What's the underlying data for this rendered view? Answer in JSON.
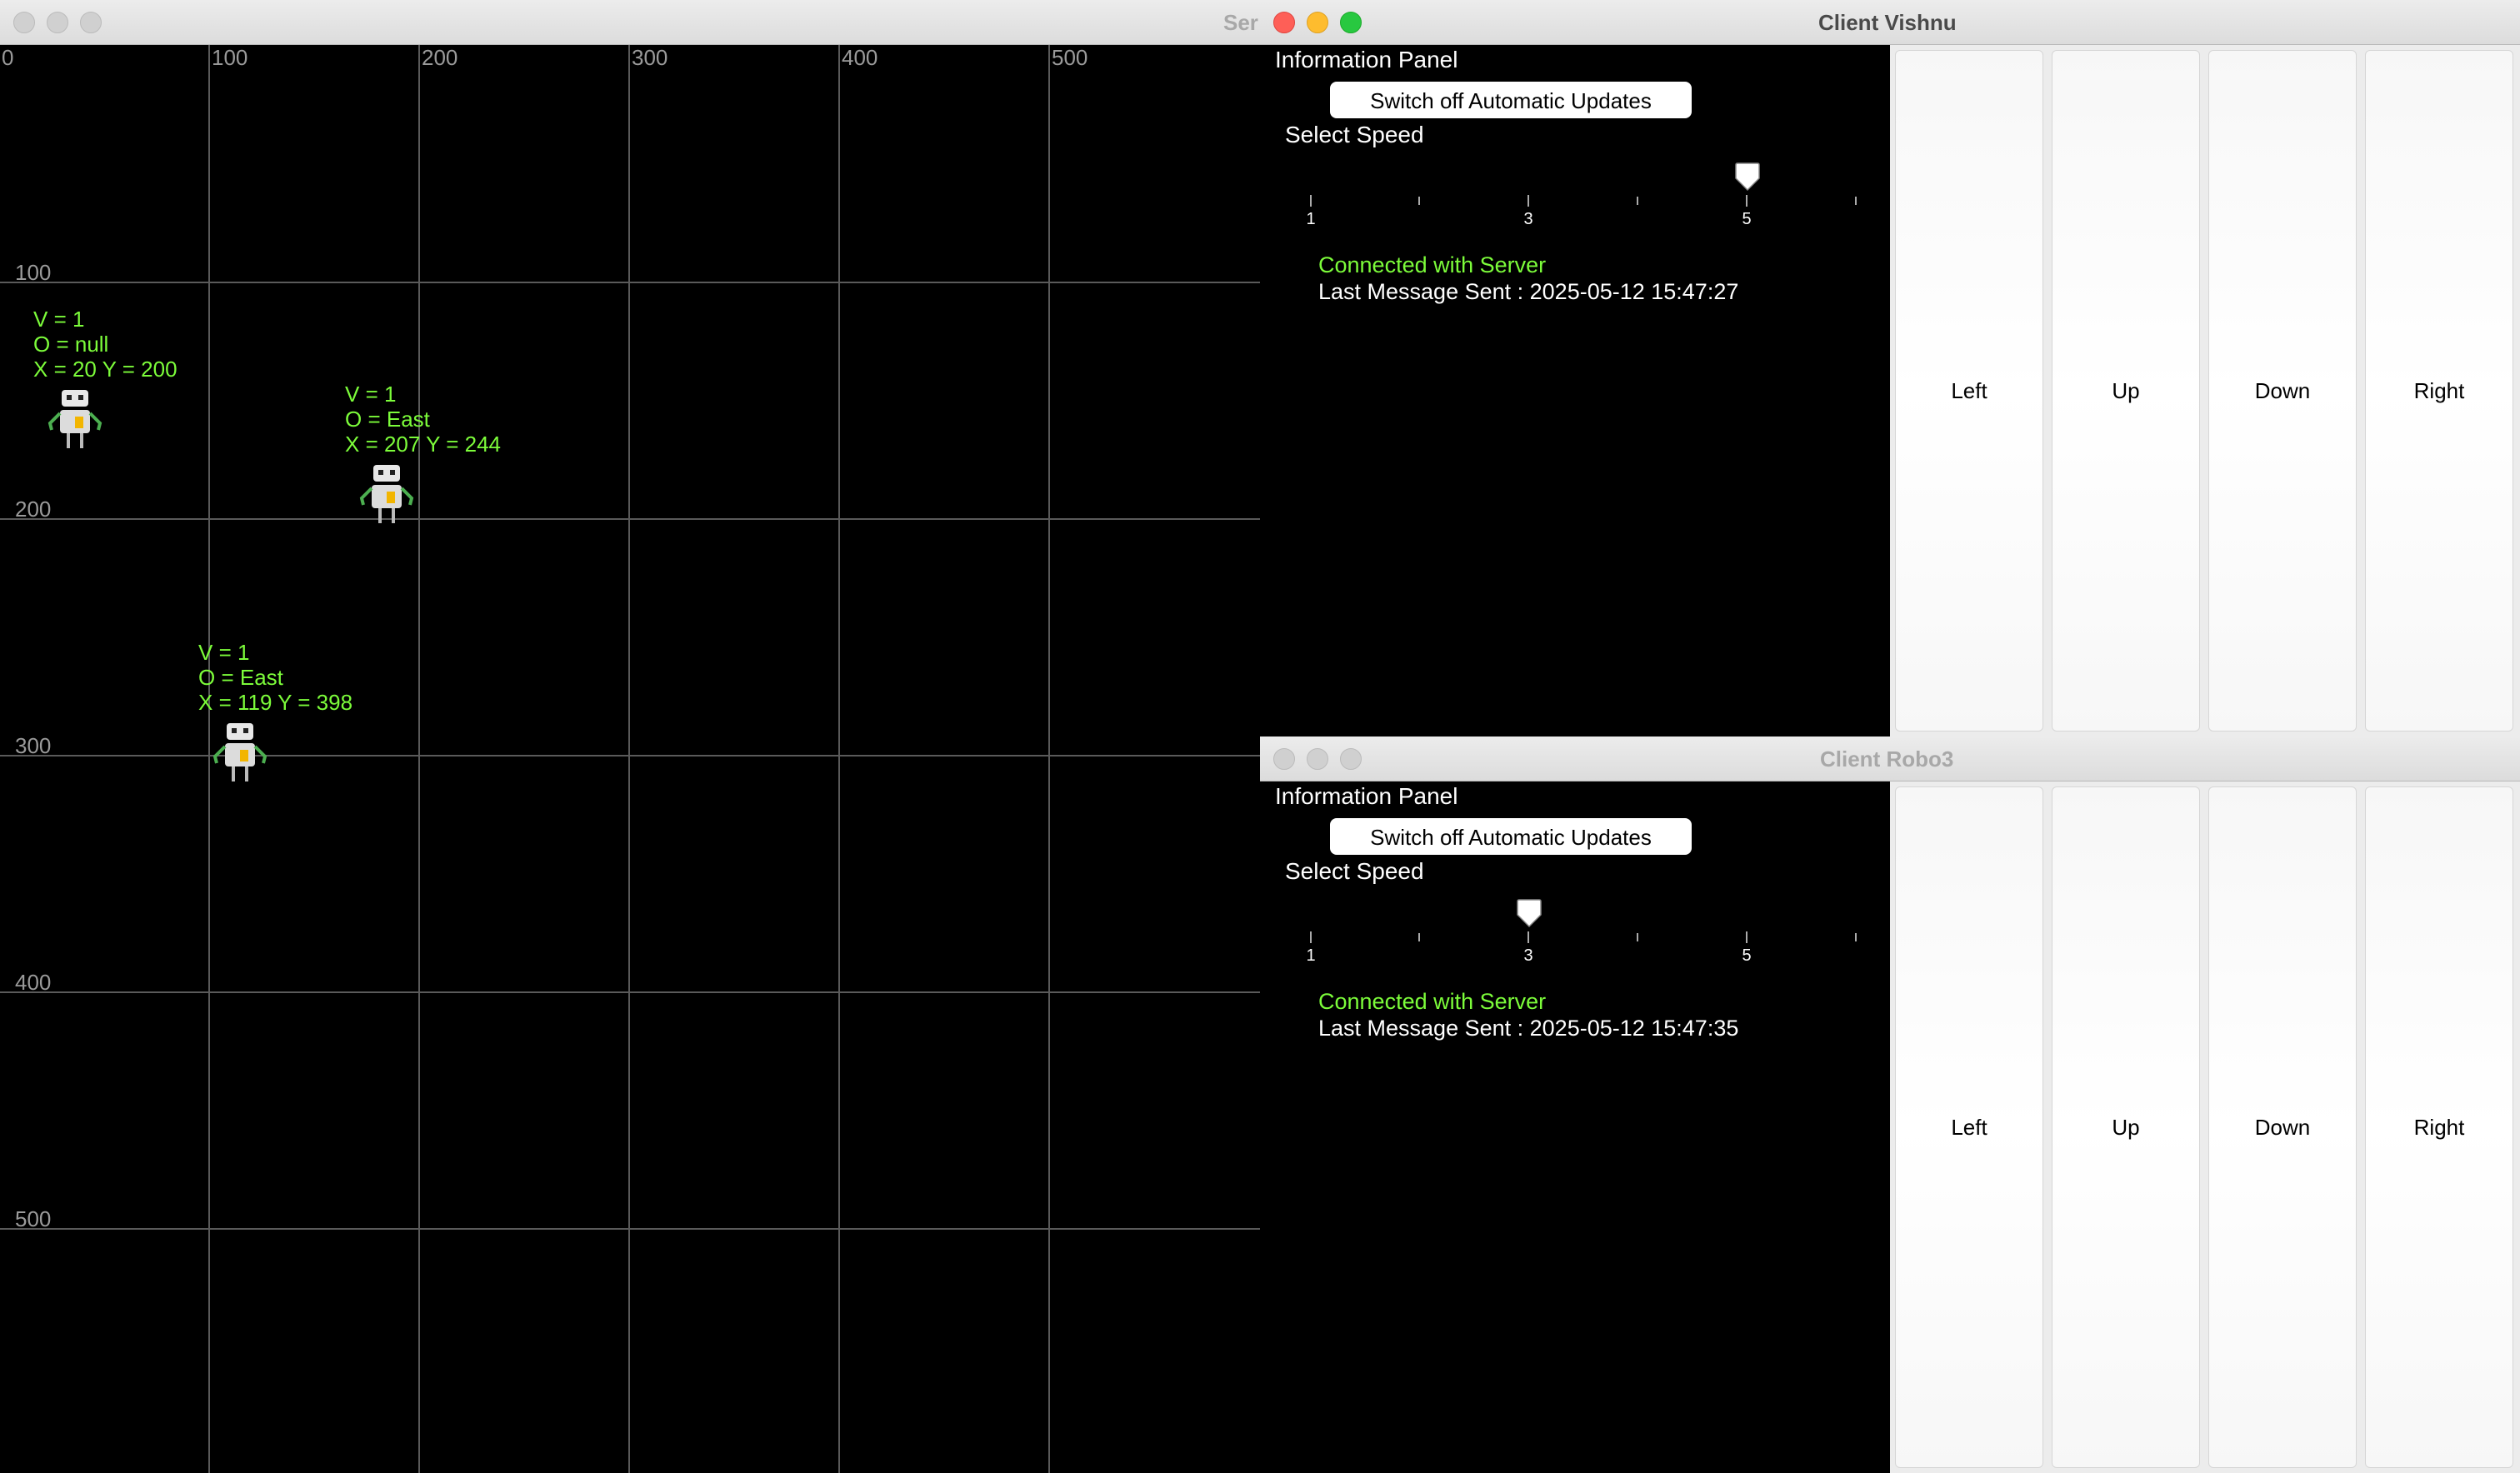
{
  "server": {
    "title": "Ser",
    "x_ticks": [
      "0",
      "100",
      "200",
      "300",
      "400",
      "500"
    ],
    "y_ticks": [
      "100",
      "200",
      "300",
      "400",
      "500"
    ],
    "robots": [
      {
        "v": "V = 1",
        "o": "O = null",
        "xy": "X = 20 Y = 200"
      },
      {
        "v": "V = 1",
        "o": "O = East",
        "xy": "X = 207 Y = 244"
      },
      {
        "v": "V = 1",
        "o": "O = East",
        "xy": "X = 119 Y = 398"
      }
    ]
  },
  "clients": [
    {
      "title": "Client Vishnu",
      "panel_title": "Information Panel",
      "toggle_label": "Switch off Automatic Updates",
      "speed_label": "Select Speed",
      "speed_ticks": [
        "1",
        "3",
        "5"
      ],
      "speed_value": 5,
      "status": "Connected with Server",
      "last_message": "Last Message Sent : 2025-05-12 15:47:27",
      "buttons": {
        "left": "Left",
        "up": "Up",
        "down": "Down",
        "right": "Right"
      }
    },
    {
      "title": "Client Robo3",
      "panel_title": "Information Panel",
      "toggle_label": "Switch off Automatic Updates",
      "speed_label": "Select Speed",
      "speed_ticks": [
        "1",
        "3",
        "5"
      ],
      "speed_value": 3,
      "status": "Connected with Server",
      "last_message": "Last Message Sent : 2025-05-12 15:47:35",
      "buttons": {
        "left": "Left",
        "up": "Up",
        "down": "Down",
        "right": "Right"
      }
    }
  ],
  "colors": {
    "accent_green": "#7CFC3A",
    "grid_line": "#5a5a5a"
  }
}
